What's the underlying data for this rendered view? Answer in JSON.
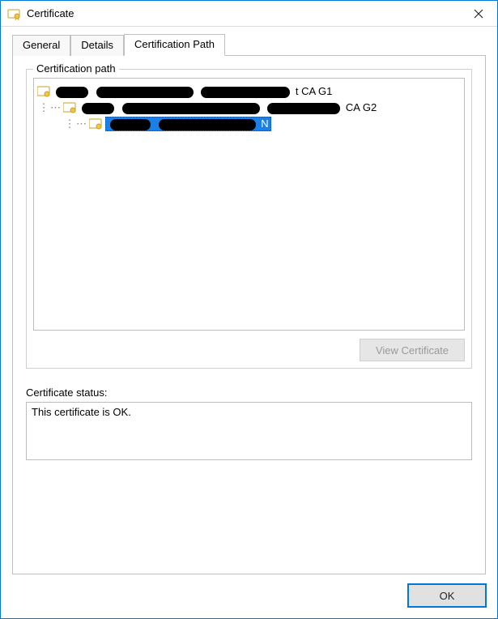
{
  "window": {
    "title": "Certificate"
  },
  "tabs": {
    "general": "General",
    "details": "Details",
    "certpath": "Certification Path"
  },
  "group": {
    "legend": "Certification path"
  },
  "tree": {
    "root_suffix": "t CA G1",
    "mid_suffix": " CA G2",
    "leaf_suffix": "N"
  },
  "buttons": {
    "view_cert": "View Certificate",
    "ok": "OK"
  },
  "status": {
    "label": "Certificate status:",
    "text": "This certificate is OK."
  }
}
